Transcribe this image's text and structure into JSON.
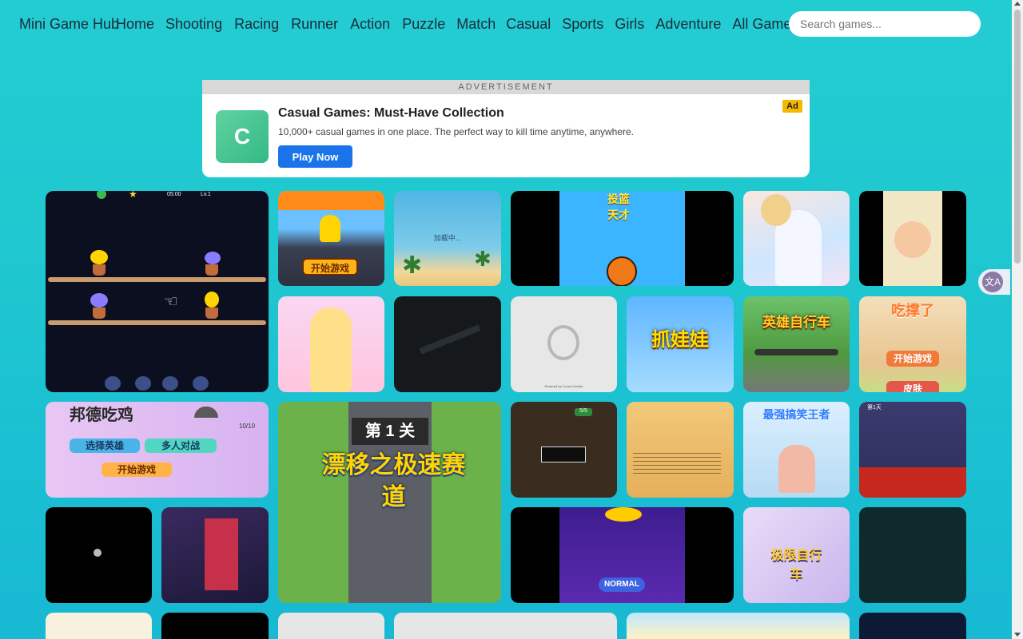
{
  "header": {
    "brand": "Mini Game Hub",
    "nav": [
      "Home",
      "Shooting",
      "Racing",
      "Runner",
      "Action",
      "Puzzle",
      "Match",
      "Casual",
      "Sports",
      "Girls",
      "Adventure",
      "All Games"
    ],
    "search_placeholder": "Search games..."
  },
  "ad": {
    "label": "ADVERTISEMENT",
    "logo_letter": "C",
    "title": "Casual Games: Must-Have Collection",
    "description": "10,000+ casual games in one place. The perfect way to kill time anytime, anywhere.",
    "button": "Play Now",
    "badge": "Ad"
  },
  "tiles": {
    "flower_timer": "05:00",
    "flower_level": "Lv.1",
    "start_game": "开始游戏",
    "start_game_2": "开始游戏",
    "skin": "皮肤",
    "loading": "加载中...",
    "basket_title_1": "投篮",
    "basket_title_2": "天才",
    "grab_title": "抓娃娃",
    "hero_bike_title": "英雄自行车",
    "stomach_title": "吃撑了",
    "burger_title": "邦德吃鸡",
    "choose_hero": "选择英雄",
    "multiplayer": "多人对战",
    "start_game_3": "开始游戏",
    "burger_score": "10/10",
    "level_label": "第 1 关",
    "drift_title": "漂移之极速赛道",
    "best_title": "最强搞笑王者",
    "normal": "NORMAL",
    "limit_bike_title": "极限自行车",
    "day_label": "第1天",
    "cocos": "Powered by Cocos Creator",
    "score_badge": "5/5"
  },
  "colors": {
    "accent": "#1a73e8",
    "badge": "#f5b800",
    "bg_top": "#22cdd2",
    "bg_bottom": "#17b9d3"
  }
}
